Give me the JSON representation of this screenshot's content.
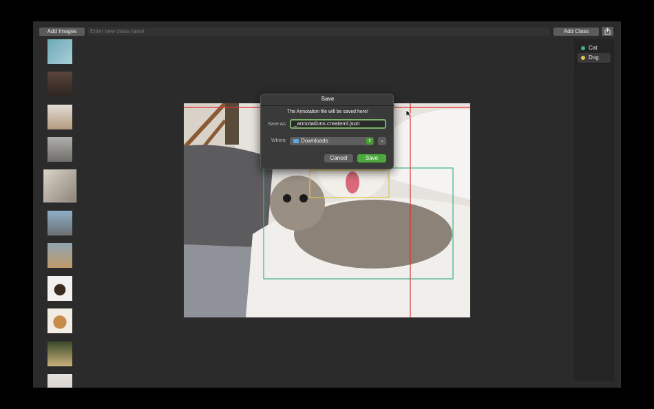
{
  "toolbar": {
    "add_images_label": "Add Images",
    "class_input_placeholder": "Enter new class name",
    "add_class_label": "Add Class",
    "share_icon": "share-icon"
  },
  "thumbnails": [
    {
      "alt": "cat-1",
      "color": "#6fa7b7"
    },
    {
      "alt": "cats-2",
      "color": "#4a3a34"
    },
    {
      "alt": "dogs-3",
      "color": "#c8c2b8"
    },
    {
      "alt": "dog-cat-4",
      "color": "#9b9a98"
    },
    {
      "alt": "cat-dog-5",
      "color": "#bfb8ae"
    },
    {
      "alt": "cats-6",
      "color": "#7b9bb3"
    },
    {
      "alt": "dogs-7",
      "color": "#8a9aa3"
    },
    {
      "alt": "dogs-8",
      "color": "#f3f1ef"
    },
    {
      "alt": "cat-dog-9",
      "color": "#e9e2d7"
    },
    {
      "alt": "dog-cat-10",
      "color": "#2f3b2a"
    },
    {
      "alt": "dog-11",
      "color": "#ddd"
    }
  ],
  "classes": [
    {
      "name": "Cat",
      "color": "#3fae8a"
    },
    {
      "name": "Dog",
      "color": "#e0c44a"
    }
  ],
  "dialog": {
    "title": "Save",
    "message": "The Annotation file will be saved here!",
    "save_as_label": "Save As:",
    "filename": "_annotations.createml.json",
    "where_label": "Where:",
    "folder": "Downloads",
    "cancel_label": "Cancel",
    "save_label": "Save"
  },
  "colors": {
    "cat_box": "#3fae8a",
    "dog_box": "#e0c44a",
    "crosshair": "#e03030",
    "save_button": "#4ca93e"
  }
}
